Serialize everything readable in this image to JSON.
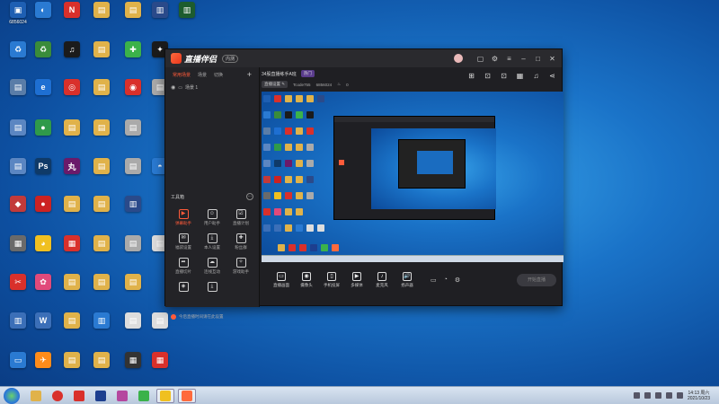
{
  "desktop": {
    "icons": [
      {
        "label": "6856024",
        "color": "#1e5fb3",
        "glyph": "▣"
      },
      {
        "label": "",
        "color": "#d9302b",
        "glyph": "N"
      },
      {
        "label": "",
        "color": "#e0b24a",
        "glyph": "▤"
      },
      {
        "label": "",
        "color": "#e0b24a",
        "glyph": "▤"
      },
      {
        "label": "",
        "color": "#e0b24a",
        "glyph": "▤"
      },
      {
        "label": "",
        "color": "#2a7ad2",
        "glyph": "▥"
      },
      {
        "label": "",
        "color": "#2a7ad2",
        "glyph": "▥"
      }
    ]
  },
  "app": {
    "title_logo": "直播伴侣",
    "version_badge": "内测",
    "tabs": [
      {
        "label": "常用场景",
        "active": true
      },
      {
        "label": "场景",
        "active": false
      },
      {
        "label": "切换",
        "active": false
      }
    ],
    "scene_name": "场景 1",
    "room_title": "34股直播练手A班",
    "badge": "热门",
    "chip": "直播设置",
    "meta1": "Tcode755",
    "meta2": "6856024",
    "meta3": "0",
    "tools_header": "工具箱",
    "tools": [
      {
        "label": "弹幕助手",
        "icon": "▶",
        "active": true
      },
      {
        "label": "用户助手",
        "icon": "☺",
        "active": false
      },
      {
        "label": "直播计划",
        "icon": "☑",
        "active": false
      },
      {
        "label": "福袋设置",
        "icon": "✉",
        "active": false
      },
      {
        "label": "本人设置",
        "icon": "⤓",
        "active": false
      },
      {
        "label": "粉丝群",
        "icon": "✚",
        "active": false
      },
      {
        "label": "直播切片",
        "icon": "➦",
        "active": false
      },
      {
        "label": "连线互动",
        "icon": "☁",
        "active": false
      },
      {
        "label": "游戏助手",
        "icon": "✧",
        "active": false
      },
      {
        "label": "",
        "icon": "◈",
        "active": false
      },
      {
        "label": "",
        "icon": "⤓",
        "active": false
      },
      {
        "label": "",
        "icon": "",
        "active": false
      }
    ],
    "notice": "今后直播时间请在此设置",
    "bottom_items": [
      {
        "label": "直播画面",
        "icon": "▭"
      },
      {
        "label": "摄像头",
        "icon": "◉"
      },
      {
        "label": "手机投屏",
        "icon": "▯"
      },
      {
        "label": "多媒体",
        "icon": "▶"
      },
      {
        "label": "麦克风",
        "icon": "♪"
      },
      {
        "label": "扬声器",
        "icon": "🔊"
      }
    ],
    "start_button": "开始直播"
  },
  "taskbar": {
    "time": "14:13 周六",
    "date": "2021/10/23",
    "apps": [
      {
        "color": "#e0b24a"
      },
      {
        "color": "#d9302b"
      },
      {
        "color": "#d9302b"
      },
      {
        "color": "#1d3f8f"
      },
      {
        "color": "#b5479f"
      },
      {
        "color": "#3bb24a"
      },
      {
        "color": "#f0c020"
      },
      {
        "color": "#ff6a3d"
      }
    ]
  }
}
